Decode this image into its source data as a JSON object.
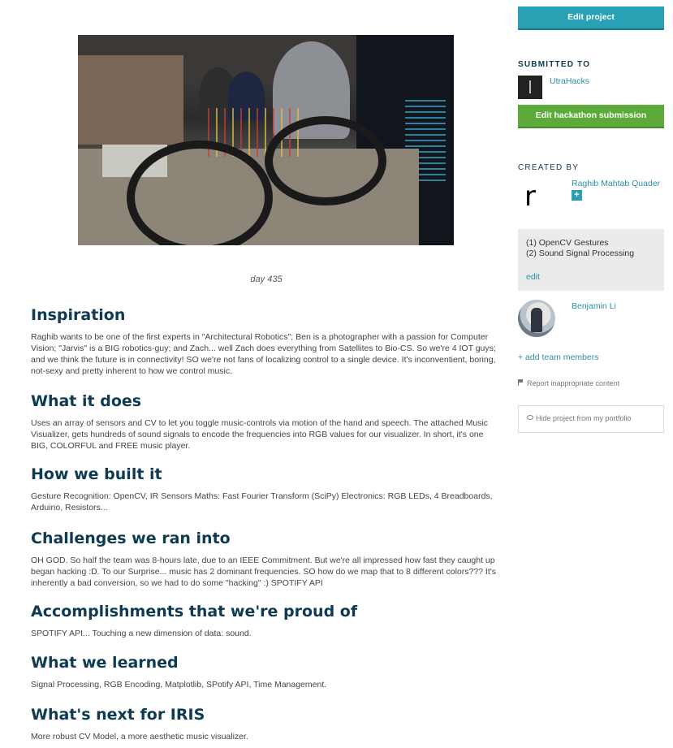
{
  "image": {
    "caption": "day 435"
  },
  "sections": [
    {
      "title": "Inspiration",
      "body": "Raghib wants to be one of the first experts in \"Architectural Robotics\"; Ben is a photographer with a passion for Computer Vision; \"Jarvis\" is a BIG robotics-guy; and Zach... well Zach does everything from Satellites to Bio-CS. So we're 4 IOT guys; and we think the future is in connectivity! SO we're not fans of localizing control to a single device. It's inconventient, boring, not-sexy and pretty inherent to how we control music."
    },
    {
      "title": "What it does",
      "body": "Uses an array of sensors and CV to let you toggle music-controls via motion of the hand and speech. The attached Music Visualizer, gets hundreds of sound signals to encode the frequencies into RGB values for our visualizer. In short, it's one BIG, COLORFUL and FREE music player."
    },
    {
      "title": "How we built it",
      "body": "Gesture Recognition: OpenCV, IR Sensors Maths: Fast Fourier Transform (SciPy) Electronics: RGB LEDs, 4 Breadboards, Arduino, Resistors..."
    },
    {
      "title": "Challenges we ran into",
      "body": "OH GOD. So half the team was 8-hours late, due to an IEEE Commitment. But we're all impressed how fast they caught up began hacking :D. To our Surprise... music has 2 dominant frequencies. SO how do we map that to 8 different colors??? It's inherently a bad conversion, so we had to do some \"hacking\" :) SPOTIFY API"
    },
    {
      "title": "Accomplishments that we're proud of",
      "body": "SPOTIFY API... Touching a new dimension of data: sound."
    },
    {
      "title": "What we learned",
      "body": "Signal Processing, RGB Encoding, Matplotlib, SPotify API, Time Management."
    },
    {
      "title": "What's next for IRIS",
      "body": "More robust CV Model, a more aesthetic music visualizer."
    }
  ],
  "sidebar": {
    "edit_project_label": "Edit project",
    "submitted_to_heading": "SUBMITTED TO",
    "hackathon_name": "UtraHacks",
    "edit_submission_label": "Edit hackathon submission",
    "created_by_heading": "CREATED BY",
    "creator_initial": "r",
    "creator_name": "Raghib Mahtab Quader",
    "creator_plus": "+",
    "roles": [
      "(1) OpenCV Gestures",
      "(2) Sound Signal Processing"
    ],
    "roles_edit": "edit",
    "member_name": "Benjamin Li",
    "add_team_members": "+ add team members",
    "report_label": "Report inappropriate content",
    "hide_label": "Hide project from my portfolio"
  },
  "colors": {
    "accent": "#2aa0b5",
    "green": "#5cab3a",
    "heading": "#0e3a52"
  }
}
